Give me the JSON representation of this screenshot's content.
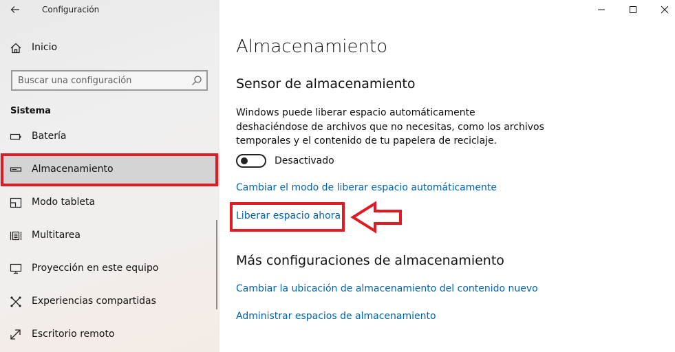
{
  "window": {
    "title": "Configuración",
    "controls": [
      "minimize-icon",
      "maximize-icon",
      "close-icon"
    ]
  },
  "sidebar": {
    "home_label": "Inicio",
    "search": {
      "placeholder": "Buscar una configuración"
    },
    "section_title": "Sistema",
    "items": [
      {
        "label": "Batería",
        "icon": "battery-icon",
        "selected": false
      },
      {
        "label": "Almacenamiento",
        "icon": "storage-icon",
        "selected": true
      },
      {
        "label": "Modo tableta",
        "icon": "tablet-mode-icon",
        "selected": false
      },
      {
        "label": "Multitarea",
        "icon": "multitasking-icon",
        "selected": false
      },
      {
        "label": "Proyección en este equipo",
        "icon": "projection-icon",
        "selected": false
      },
      {
        "label": "Experiencias compartidas",
        "icon": "shared-experiences-icon",
        "selected": false
      },
      {
        "label": "Escritorio remoto",
        "icon": "remote-desktop-icon",
        "selected": false
      }
    ]
  },
  "main": {
    "title": "Almacenamiento",
    "storage_sense": {
      "heading": "Sensor de almacenamiento",
      "description": "Windows puede liberar espacio automáticamente deshaciéndose de archivos que no necesitas, como los archivos temporales y el contenido de tu papelera de reciclaje.",
      "toggle_label": "Desactivado",
      "toggle_on": false,
      "link_change_mode": "Cambiar el modo de liberar espacio automáticamente",
      "link_free_now": "Liberar espacio ahora"
    },
    "more_settings": {
      "heading": "Más configuraciones de almacenamiento",
      "link_change_location": "Cambiar la ubicación de almacenamiento del contenido nuevo",
      "link_manage_spaces": "Administrar espacios de almacenamiento"
    }
  },
  "colors": {
    "accent_link": "#0063b1",
    "annotation_red": "#e11b24",
    "selected_bg": "#d4d4d4"
  }
}
